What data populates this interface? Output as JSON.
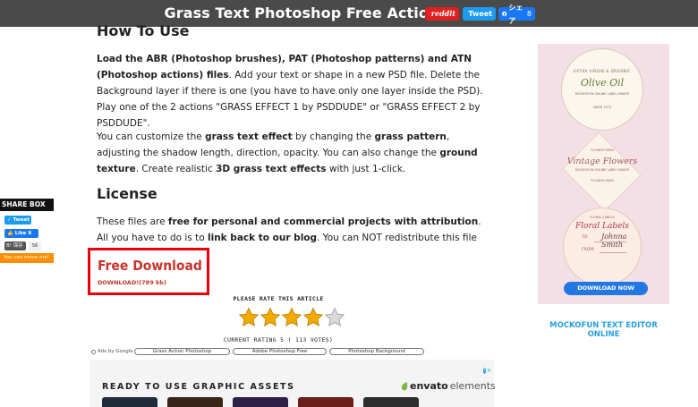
{
  "topbar": {
    "title": "Grass Text Photoshop Free Action",
    "reddit_label": "reddit",
    "tweet_label": "Tweet",
    "share_label": "シェア",
    "share_count": "8"
  },
  "article": {
    "howto_heading": "How To Use",
    "p1": [
      {
        "b": "Load the ABR (Photoshop brushes), PAT (Photoshop patterns) and ATN (Photoshop actions) files"
      },
      {
        "t": ". Add your text or shape in a new PSD file. Delete the Background layer if there is one (you have to have only one layer inside the PSD). Play one of the 2 actions \"GRASS EFFECT 1 by PSDDUDE\" or \"GRASS EFFECT 2 by PSDDUDE\"."
      }
    ],
    "p2": [
      {
        "t": "You can customize the "
      },
      {
        "b": "grass text effect"
      },
      {
        "t": " by changing the "
      },
      {
        "b": "grass pattern"
      },
      {
        "t": ", adjusting the shadow length, direction, opacity. You can also change the "
      },
      {
        "b": "ground texture"
      },
      {
        "t": ". Create realistic "
      },
      {
        "b": "3D grass text effects"
      },
      {
        "t": " with just 1-click."
      }
    ],
    "license_heading": "License",
    "p3": [
      {
        "t": "These files are "
      },
      {
        "b": "free for personal and commercial projects with attribution"
      },
      {
        "t": ". All you have to do is to "
      },
      {
        "b": "link back to our blog"
      },
      {
        "t": ". You can NOT redistribute this file on other websites."
      }
    ]
  },
  "download": {
    "title": "Free Download",
    "link": "DOWNLOAD!(789 kb)"
  },
  "rating": {
    "label": "PLEASE RATE THIS ARTICLE",
    "stars_filled": 4,
    "stars_total": 5,
    "text": "CURRENT RATING 5 ( 113 VOTES)"
  },
  "ads_row": {
    "ads_by": "Ads by Google",
    "links": [
      "Grass Action Photoshop",
      "Adobe Photoshop Free",
      "Photoshop Background"
    ]
  },
  "envato_ad": {
    "heading": "READY TO USE GRAPHIC ASSETS",
    "brand_bold": "envato",
    "brand_light": "elements",
    "thumb_colors": [
      "#1f2a3a",
      "#3a2418",
      "#2c2145",
      "#6a1f1a",
      "#2d2d2d"
    ]
  },
  "share_box": {
    "heading": "SHARE BOX",
    "tweet": "Tweet",
    "like": "Like 8",
    "hatena": "保存",
    "hatena_count": "56",
    "move": "You can move me!"
  },
  "sidebar_ad": {
    "olive_top": "EXTRA VIRGIN & ORGANIC",
    "olive_title": "Olive Oil",
    "olive_sub": "MOCKOFUN ONLINE LABEL MAKER",
    "olive_since": "SINCE 1975",
    "vintage_top": "FLOWER FARM",
    "vintage_title": "Vintage Flowers",
    "vintage_sub": "MOCKOFUN ONLINE LABEL MAKER",
    "vintage_bottom": "FLOWER FARM",
    "floral_top": "FLORAL LABELS",
    "floral_title": "Floral Labels",
    "floral_to": "TO:",
    "floral_name": "Johnna Smith",
    "floral_from": "FROM:",
    "button": "DOWNLOAD NOW"
  },
  "sidebar_link": "MOCKOFUN TEXT EDITOR ONLINE",
  "colors": {
    "topbar_bg": "#4a4a4a",
    "download_red": "#c8342c",
    "box_border": "#e8000b",
    "star_gold": "#f2a900",
    "link_blue": "#2aa0dd"
  }
}
